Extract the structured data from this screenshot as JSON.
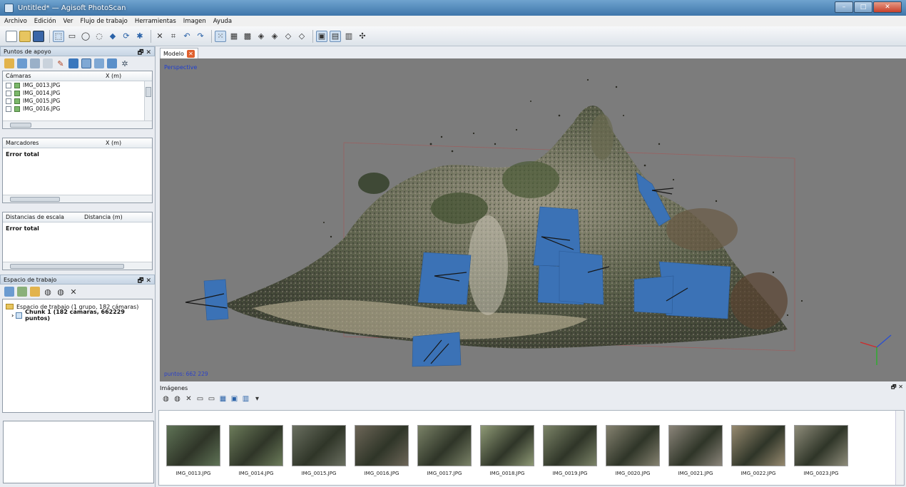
{
  "window": {
    "title": "Untitled* — Agisoft PhotoScan",
    "buttons": [
      "–",
      "□",
      "✕"
    ]
  },
  "menu": [
    "Archivo",
    "Edición",
    "Ver",
    "Flujo de trabajo",
    "Herramientas",
    "Imagen",
    "Ayuda"
  ],
  "left": {
    "gcp_panel": {
      "title": "Puntos de apoyo",
      "controls": "🗗 ✕"
    },
    "cameras": {
      "col1": "Cámaras",
      "col2": "X (m)",
      "rows": [
        "IMG_0013.JPG",
        "IMG_0014.JPG",
        "IMG_0015.JPG",
        "IMG_0016.JPG"
      ]
    },
    "markers": {
      "col1": "Marcadores",
      "col2": "X (m)",
      "total": "Error total"
    },
    "scale": {
      "col1": "Distancias de escala",
      "col2": "Distancia (m)",
      "total": "Error total"
    },
    "workspace": {
      "title": "Espacio de trabajo",
      "controls": "🗗 ✕",
      "root": "Espacio de trabajo (1 grupo, 182 cámaras)",
      "chunk": "Chunk 1 (182 cámaras, 662229 puntos)"
    }
  },
  "viewport": {
    "tab": "Modelo",
    "mode": "Perspective",
    "points": "puntos: 662 229"
  },
  "images": {
    "title": "Imágenes",
    "controls": "🗗 ✕",
    "thumbs": [
      {
        "name": "IMG_0013.JPG",
        "color": "#5f7356"
      },
      {
        "name": "IMG_0014.JPG",
        "color": "#6c7c5a"
      },
      {
        "name": "IMG_0015.JPG",
        "color": "#6a6f60"
      },
      {
        "name": "IMG_0016.JPG",
        "color": "#6d6658"
      },
      {
        "name": "IMG_0017.JPG",
        "color": "#7a8267"
      },
      {
        "name": "IMG_0018.JPG",
        "color": "#8f9a76"
      },
      {
        "name": "IMG_0019.JPG",
        "color": "#7c8468"
      },
      {
        "name": "IMG_0020.JPG",
        "color": "#858270"
      },
      {
        "name": "IMG_0021.JPG",
        "color": "#8b857a"
      },
      {
        "name": "IMG_0022.JPG",
        "color": "#978a70"
      },
      {
        "name": "IMG_0023.JPG",
        "color": "#8e8c7a"
      }
    ]
  },
  "colors": {
    "camera_blue": "#3b72b6",
    "viewport_bg": "#7c7c7c"
  }
}
